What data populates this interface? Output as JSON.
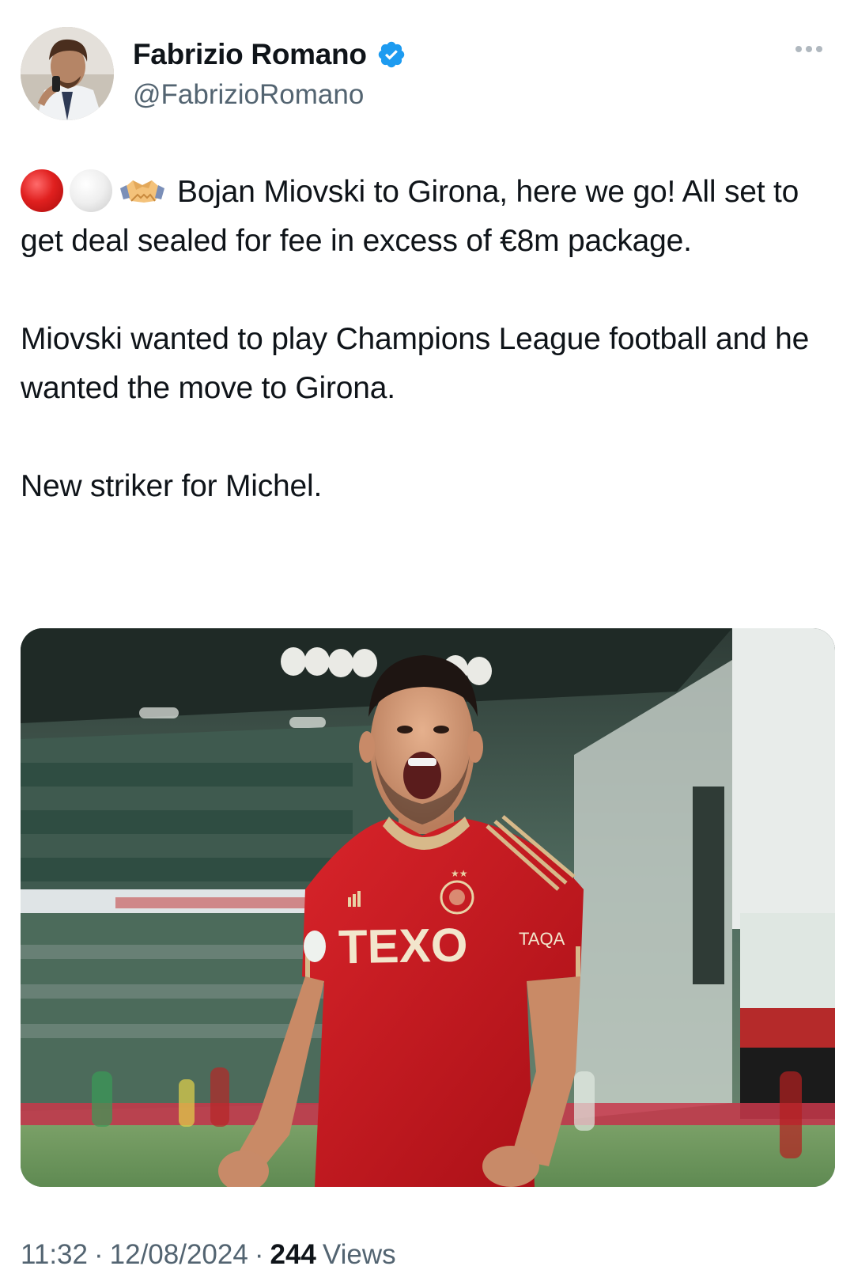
{
  "author": {
    "display_name": "Fabrizio Romano",
    "handle": "@FabrizioRomano",
    "verified": true,
    "verified_color": "#1d9bf0",
    "avatar_icon": "profile-photo"
  },
  "more_icon": "ellipsis-icon",
  "tweet": {
    "emojis": [
      "red-circle-emoji",
      "white-circle-emoji",
      "handshake-emoji"
    ],
    "paragraph_1": "Bojan Miovski to Girona, here we go! All set to get deal sealed for fee in excess of €8m package.",
    "paragraph_2": "Miovski wanted to play Champions League football and he wanted the move to Girona.",
    "paragraph_3": "New striker for Michel."
  },
  "media": {
    "shirt_sponsor": "TEXO",
    "sleeve_sponsor": "TAQA"
  },
  "meta": {
    "time": "11:32",
    "separator": "·",
    "date": "12/08/2024",
    "views_count": "244",
    "views_label": "Views"
  },
  "colors": {
    "text_primary": "#0f1419",
    "text_secondary": "#536471",
    "shirt_red": "#c8141c"
  }
}
